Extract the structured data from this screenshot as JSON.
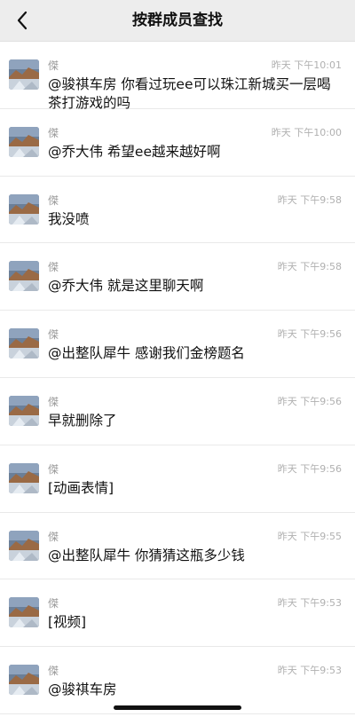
{
  "header": {
    "title": "按群成员查找",
    "back_icon": "chevron-left-icon"
  },
  "messages": [
    {
      "name": "傑",
      "time": "昨天 下午10:01",
      "text": "@骏祺车房 你看过玩ee可以珠江新城买一层喝茶打游戏的吗"
    },
    {
      "name": "傑",
      "time": "昨天 下午10:00",
      "text": "@乔大伟 希望ee越来越好啊"
    },
    {
      "name": "傑",
      "time": "昨天 下午9:58",
      "text": "我没喷"
    },
    {
      "name": "傑",
      "time": "昨天 下午9:58",
      "text": "@乔大伟 就是这里聊天啊"
    },
    {
      "name": "傑",
      "time": "昨天 下午9:56",
      "text": "@出整队犀牛 感谢我们金榜题名"
    },
    {
      "name": "傑",
      "time": "昨天 下午9:56",
      "text": "早就删除了"
    },
    {
      "name": "傑",
      "time": "昨天 下午9:56",
      "text": "[动画表情]"
    },
    {
      "name": "傑",
      "time": "昨天 下午9:55",
      "text": "@出整队犀牛 你猜猜这瓶多少钱"
    },
    {
      "name": "傑",
      "time": "昨天 下午9:53",
      "text": "[视频]"
    },
    {
      "name": "傑",
      "time": "昨天 下午9:53",
      "text": "@骏祺车房"
    }
  ],
  "colors": {
    "header_bg": "#ededed",
    "time_text": "#b0b0b0",
    "name_text": "#9a9a9a"
  }
}
